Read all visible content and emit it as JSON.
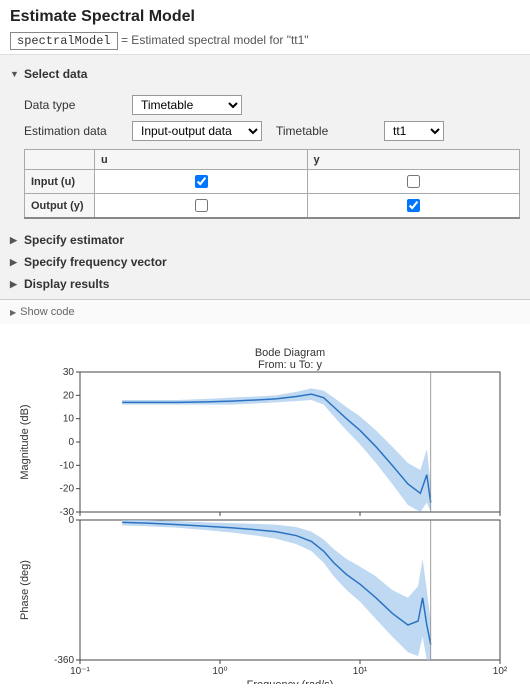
{
  "header": {
    "title": "Estimate Spectral Model",
    "varname": "spectralModel",
    "desc": "= Estimated spectral model for \"tt1\""
  },
  "sections": {
    "select_data": {
      "label": "Select data",
      "data_type_label": "Data type",
      "data_type_value": "Timetable",
      "est_data_label": "Estimation data",
      "est_data_value": "Input-output data",
      "timetable_label": "Timetable",
      "timetable_value": "tt1",
      "grid": {
        "cols": [
          "u",
          "y"
        ],
        "rows": [
          {
            "label": "Input (u)",
            "checks": [
              true,
              false
            ]
          },
          {
            "label": "Output (y)",
            "checks": [
              false,
              true
            ]
          }
        ]
      }
    },
    "specify_estimator": {
      "label": "Specify estimator"
    },
    "specify_freq": {
      "label": "Specify frequency vector"
    },
    "display_results": {
      "label": "Display results"
    }
  },
  "showcode": "Show code",
  "chart_data": [
    {
      "type": "line",
      "title": "Bode Diagram",
      "subtitle": "From: u  To: y",
      "xlabel": "Frequency  (rad/s)",
      "ylabel": "Magnitude (dB)",
      "x_scale": "log",
      "xlim": [
        0.1,
        100
      ],
      "ylim": [
        -30,
        30
      ],
      "yticks": [
        -30,
        -20,
        -10,
        0,
        10,
        20,
        30
      ],
      "xticks": [
        0.1,
        1,
        10,
        100
      ],
      "xtick_labels": [
        "10⁻¹",
        "10⁰",
        "10¹",
        "10²"
      ],
      "x": [
        0.2,
        0.3,
        0.5,
        0.8,
        1.2,
        1.8,
        2.5,
        3.5,
        4.5,
        5.5,
        6.5,
        8,
        10,
        13,
        17,
        22,
        27,
        30,
        32
      ],
      "values": [
        17,
        17,
        17,
        17.2,
        17.5,
        18,
        18.5,
        19.5,
        20.5,
        19,
        15,
        10,
        5,
        -2,
        -10,
        -18,
        -22,
        -14,
        -26
      ],
      "band_lower": [
        16,
        16,
        16,
        16,
        16,
        16.5,
        17,
        17.5,
        18,
        16,
        11,
        5,
        -1,
        -9,
        -18,
        -27,
        -30,
        -26,
        -30
      ],
      "band_upper": [
        18,
        18,
        18,
        18.5,
        19,
        19.5,
        20,
        21.5,
        23,
        22,
        19,
        15,
        11,
        5,
        -2,
        -9,
        -12,
        -3,
        -18
      ]
    },
    {
      "type": "line",
      "ylabel": "Phase (deg)",
      "x_scale": "log",
      "xlim": [
        0.1,
        100
      ],
      "ylim": [
        -360,
        0
      ],
      "yticks": [
        -360,
        0
      ],
      "x": [
        0.2,
        0.3,
        0.5,
        0.8,
        1.2,
        1.8,
        2.5,
        3.5,
        4.5,
        5.5,
        6.5,
        8,
        10,
        13,
        17,
        22,
        26,
        28,
        30,
        32
      ],
      "values": [
        -6,
        -8,
        -12,
        -16,
        -20,
        -25,
        -30,
        -40,
        -55,
        -80,
        -110,
        -140,
        -165,
        -200,
        -240,
        -270,
        -260,
        -200,
        -270,
        -320
      ],
      "band_lower": [
        -14,
        -16,
        -20,
        -26,
        -32,
        -40,
        -48,
        -62,
        -80,
        -110,
        -145,
        -180,
        -210,
        -255,
        -300,
        -340,
        -350,
        -300,
        -360,
        -360
      ],
      "band_upper": [
        0,
        0,
        -3,
        -6,
        -8,
        -10,
        -12,
        -18,
        -30,
        -50,
        -75,
        -100,
        -120,
        -145,
        -180,
        -200,
        -170,
        -100,
        -180,
        -260
      ]
    }
  ]
}
